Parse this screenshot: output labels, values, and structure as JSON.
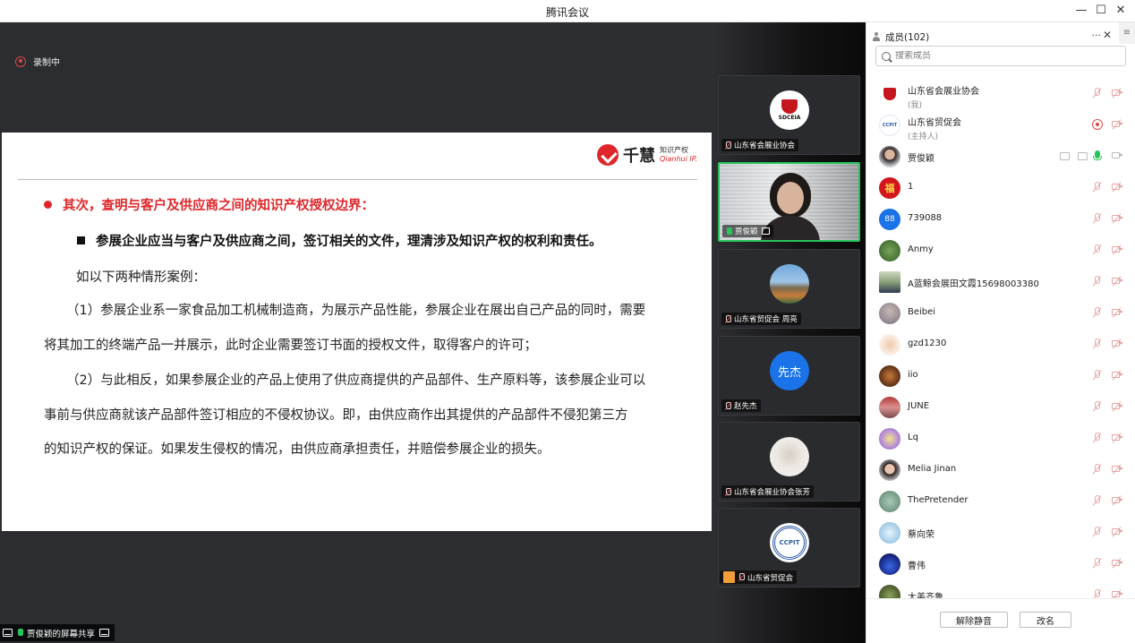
{
  "window": {
    "title": "腾讯会议",
    "minimize": "—",
    "maximize": "☐",
    "close": "✕"
  },
  "stage": {
    "recording_label": "录制中",
    "share_label": "贾俊颖的屏幕共享"
  },
  "slide": {
    "logo_cn": "千慧",
    "logo_sub1": "知识产权",
    "logo_sub2": "Qianhui IP.",
    "heading": "其次，查明与客户及供应商之间的知识产权授权边界：",
    "subheading": "参展企业应当与客户及供应商之间，签订相关的文件，理清涉及知识产权的权利和责任。",
    "intro": "如以下两种情形案例：",
    "case1_line1": "（1）参展企业系一家食品加工机械制造商，为展示产品性能，参展企业在展出自己产品的同时，需要",
    "case1_line2": "将其加工的终端产品一并展示，此时企业需要签订书面的授权文件，取得客户的许可；",
    "case2_line1": "（2）与此相反，如果参展企业的产品上使用了供应商提供的产品部件、生产原料等，该参展企业可以",
    "case2_line2": "事前与供应商就该产品部件签订相应的不侵权协议。即，由供应商作出其提供的产品部件不侵犯第三方",
    "case2_line3": "的知识产权的保证。如果发生侵权的情况，由供应商承担责任，并赔偿参展企业的损失。"
  },
  "tiles": [
    {
      "label": "山东省会展业协会",
      "avatar_text": "SDCEIA"
    },
    {
      "label": "贾俊颖"
    },
    {
      "label": "山东省贸促会 周亮"
    },
    {
      "label": "赵先杰",
      "avatar_text": "先杰"
    },
    {
      "label": "山东省会展业协会张芳"
    },
    {
      "label": "山东省贸促会",
      "avatar_text": "CCPIT"
    }
  ],
  "panel": {
    "title": "成员(102)",
    "more": "···",
    "close": "✕",
    "side": "≡",
    "search_placeholder": "搜索成员",
    "members": [
      {
        "name": "山东省会展业协会",
        "sub": "(我)"
      },
      {
        "name": "山东省贸促会",
        "sub": "(主持人)"
      },
      {
        "name": "贾俊颖"
      },
      {
        "name": "1",
        "avatar_text": "福"
      },
      {
        "name": "739088",
        "avatar_text": "88"
      },
      {
        "name": "Anmy"
      },
      {
        "name": "A蓝鲸会展田文霞15698003380"
      },
      {
        "name": "Beibei"
      },
      {
        "name": "gzd1230"
      },
      {
        "name": "iio"
      },
      {
        "name": "JUNE"
      },
      {
        "name": "Lq"
      },
      {
        "name": "Melia Jinan"
      },
      {
        "name": "ThePretender"
      },
      {
        "name": "蔡向荣"
      },
      {
        "name": "曹伟"
      },
      {
        "name": "大美齐鲁"
      }
    ],
    "unmute_all": "解除静音",
    "rename": "改名"
  }
}
